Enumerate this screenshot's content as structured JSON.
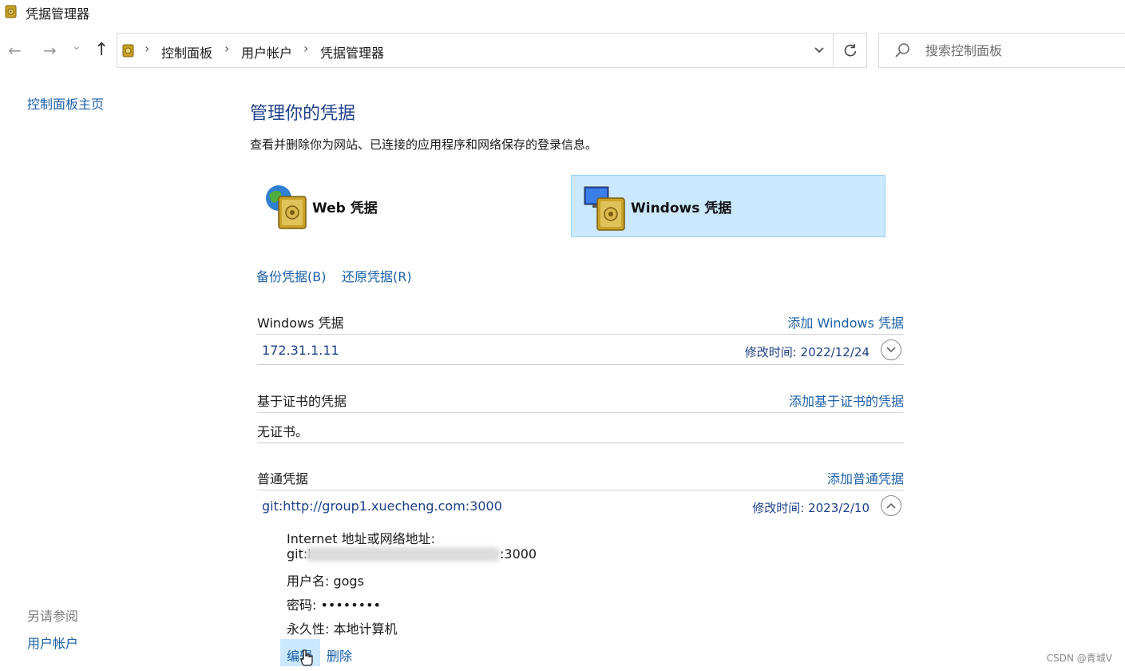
{
  "window": {
    "title": "凭据管理器"
  },
  "nav": {
    "back_glyph": "←",
    "forward_glyph": "→",
    "recent_glyph": "⌄",
    "up_glyph": "↑"
  },
  "breadcrumb": [
    "控制面板",
    "用户帐户",
    "凭据管理器"
  ],
  "breadcrumb_sep": "›",
  "search": {
    "placeholder": "搜索控制面板"
  },
  "left_pane": {
    "home_link": "控制面板主页",
    "see_also_heading": "另请参阅",
    "see_also_link": "用户帐户"
  },
  "main": {
    "heading": "管理你的凭据",
    "description": "查看并删除你为网站、已连接的应用程序和网络保存的登录信息。",
    "tiles": {
      "web": "Web 凭据",
      "windows": "Windows 凭据",
      "selected": "windows"
    },
    "backup_link": "备份凭据(B)",
    "restore_link": "还原凭据(R)",
    "windows_section": {
      "title": "Windows 凭据",
      "add_link": "添加 Windows 凭据",
      "entries": [
        {
          "name": "172.31.1.11",
          "modified": "修改时间: 2022/12/24"
        }
      ]
    },
    "cert_section": {
      "title": "基于证书的凭据",
      "add_link": "添加基于证书的凭据",
      "empty_text": "无证书。"
    },
    "generic_section": {
      "title": "普通凭据",
      "add_link": "添加普通凭据",
      "entries": [
        {
          "name": "git:http://group1.xuecheng.com:3000",
          "modified": "修改时间: 2023/2/10",
          "expanded": true,
          "details": {
            "address_label": "Internet 地址或网络地址:",
            "address_prefix": "git:h",
            "address_suffix": ":3000",
            "username_line": "用户名: gogs",
            "password_line": "密码: ••••••••",
            "persistence_line": "永久性: 本地计算机"
          },
          "actions": {
            "edit": "编辑",
            "delete": "删除"
          }
        }
      ]
    }
  },
  "watermark": "CSDN @青城V",
  "colors": {
    "link": "#1a5fa8",
    "heading": "#1e3f8a",
    "selected_tile": "#cce8ff"
  }
}
